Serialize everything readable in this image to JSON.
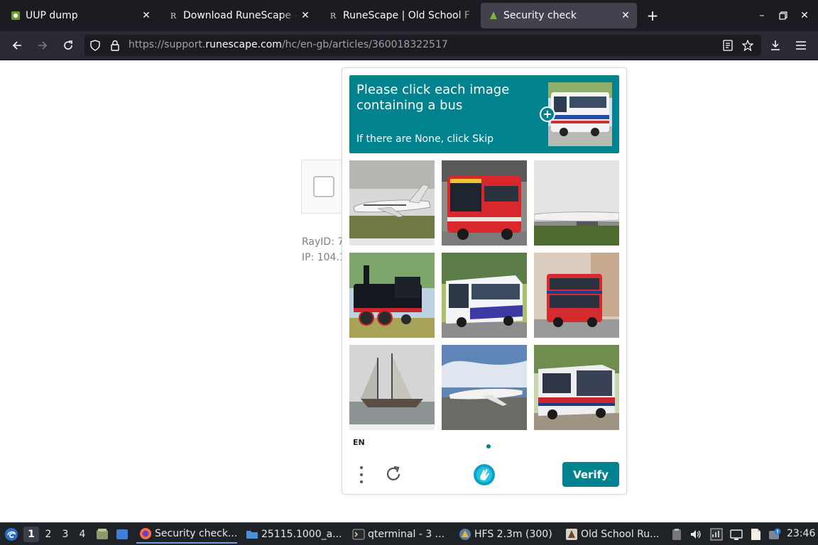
{
  "browser": {
    "tabs": [
      {
        "title": "UUP dump",
        "active": false
      },
      {
        "title": "Download RuneScape - R",
        "active": false
      },
      {
        "title": "RuneScape | Old School F",
        "active": false
      },
      {
        "title": "Security check",
        "active": true
      }
    ],
    "url": {
      "prefix": "https://support.",
      "host": "runescape.com",
      "path": "/hc/en-gb/articles/360018322517"
    }
  },
  "page": {
    "ray_id": "RayID: 7",
    "ip": "IP: 104.1"
  },
  "captcha": {
    "prompt": "Please click each image containing a bus",
    "hint": "If there are None, click Skip",
    "grid": [
      {
        "label": "airplane"
      },
      {
        "label": "red-bus"
      },
      {
        "label": "airplane"
      },
      {
        "label": "steam-locomotive"
      },
      {
        "label": "white-bus"
      },
      {
        "label": "red-double-decker-bus"
      },
      {
        "label": "sailboat"
      },
      {
        "label": "airplane"
      },
      {
        "label": "bus"
      }
    ],
    "language": "EN",
    "verify_label": "Verify",
    "accent": "#00838f"
  },
  "taskbar": {
    "workspaces": [
      "1",
      "2",
      "3",
      "4"
    ],
    "tasks": [
      {
        "label": "Security check..."
      },
      {
        "label": "25115.1000_a..."
      },
      {
        "label": "qterminal - 3 ..."
      },
      {
        "label": "HFS 2.3m (300)"
      },
      {
        "label": "Old School Ru..."
      }
    ],
    "clock": "23:46"
  }
}
